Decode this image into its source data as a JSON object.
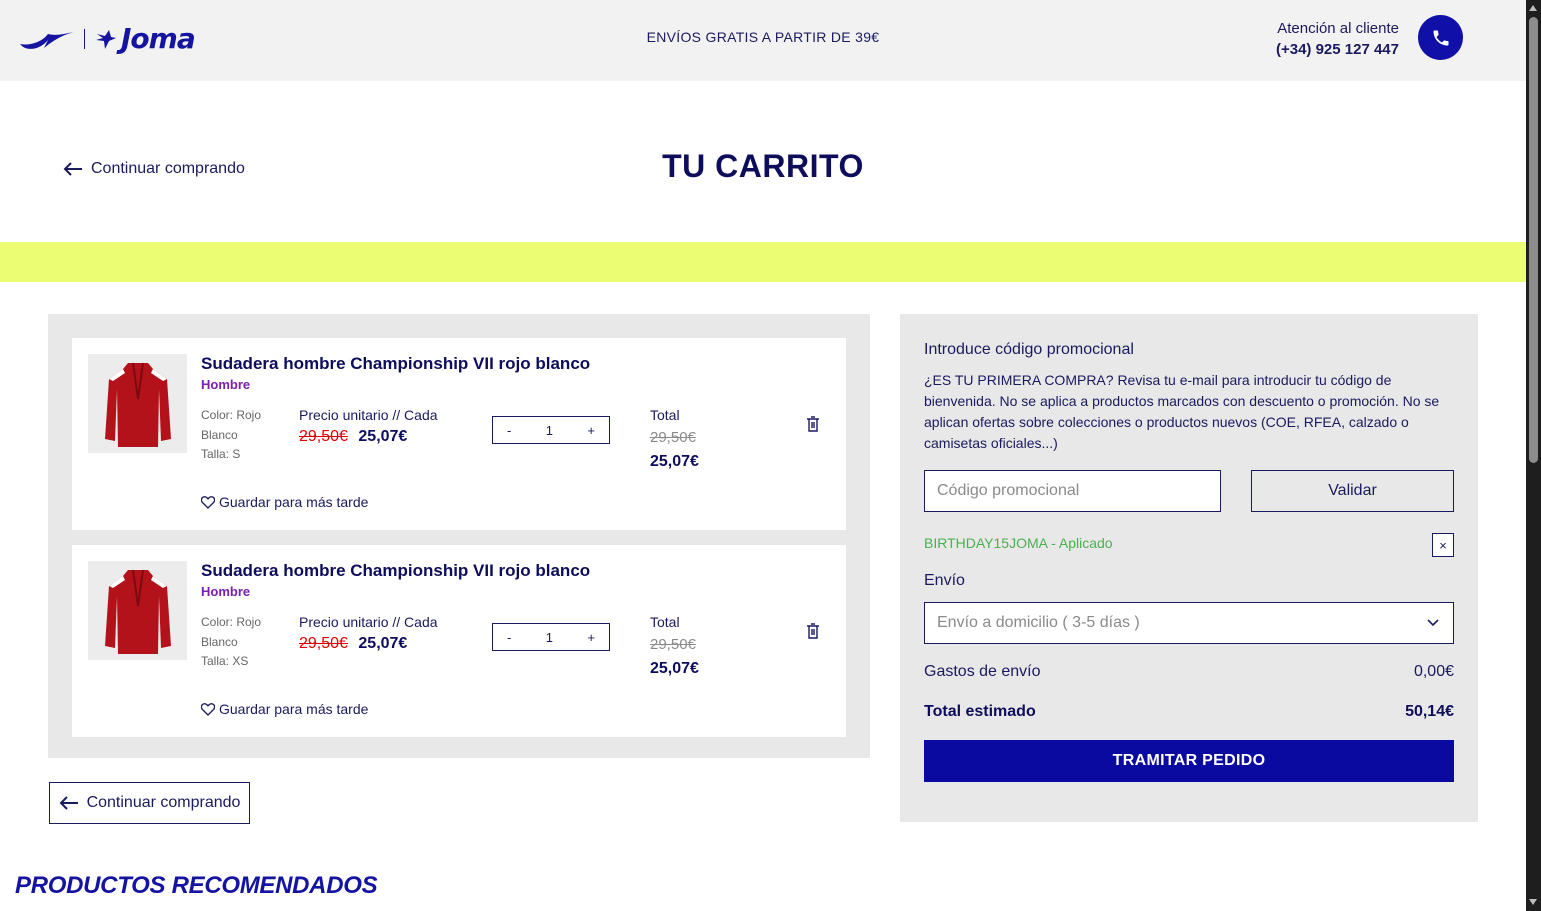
{
  "header": {
    "brand": "Joma",
    "shipping_message": "ENVÍOS GRATIS A PARTIR DE 39€",
    "support_label": "Atención al cliente",
    "support_phone": "(+34) 925 127 447"
  },
  "page": {
    "back_link": "Continuar comprando",
    "title": "TU CARRITO"
  },
  "cart": {
    "unit_label": "Precio unitario // Cada",
    "total_label": "Total",
    "save_later": "Guardar para más tarde",
    "items": [
      {
        "name": "Sudadera hombre Championship VII rojo blanco",
        "gender": "Hombre",
        "color": "Color: Rojo Blanco",
        "size": "Talla: S",
        "old_price": "29,50€",
        "price": "25,07€",
        "quantity": "1",
        "total_old": "29,50€",
        "total": "25,07€"
      },
      {
        "name": "Sudadera hombre Championship VII rojo blanco",
        "gender": "Hombre",
        "color": "Color: Rojo Blanco",
        "size": "Talla: XS",
        "old_price": "29,50€",
        "price": "25,07€",
        "quantity": "1",
        "total_old": "29,50€",
        "total": "25,07€"
      }
    ],
    "qty_minus": "-",
    "qty_plus": "+",
    "back_button": "Continuar comprando"
  },
  "summary": {
    "promo_title": "Introduce código promocional",
    "promo_description": "¿ES TU PRIMERA COMPRA? Revisa tu e-mail para introducir tu código de bienvenida. No se aplica a productos marcados con descuento o promoción. No se aplican ofertas sobre colecciones o productos nuevos (COE, RFEA, calzado o camisetas oficiales...)",
    "promo_placeholder": "Código promocional",
    "validate_label": "Validar",
    "applied_code": "BIRTHDAY15JOMA - Aplicado",
    "remove_code": "×",
    "shipping_label": "Envío",
    "shipping_option": "Envío a domicilio ( 3-5 días )",
    "shipping_cost_label": "Gastos de envío",
    "shipping_cost": "0,00€",
    "total_label": "Total estimado",
    "total": "50,14€",
    "checkout_label": "TRAMITAR PEDIDO"
  },
  "recommended": {
    "title": "PRODUCTOS RECOMENDADOS"
  },
  "colors": {
    "brand_blue": "#0a0aa0",
    "accent_lime": "#ebfd72",
    "sale_red": "#e00000",
    "applied_green": "#4caf50"
  }
}
